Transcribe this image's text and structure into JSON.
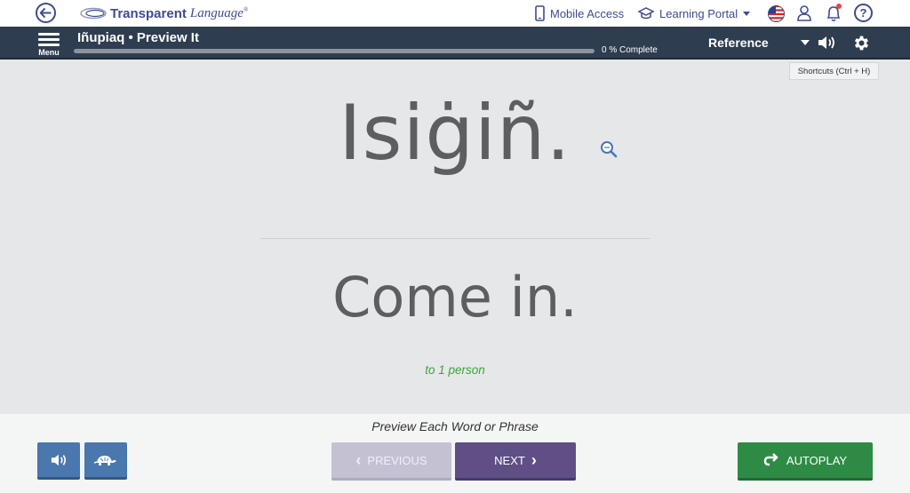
{
  "header": {
    "brand": "Transparent",
    "brand_suffix": "Language",
    "mobile_access": "Mobile Access",
    "learning_portal": "Learning Portal",
    "help": "?"
  },
  "navbar": {
    "menu_label": "Menu",
    "lesson_title": "Iñupiaq • Preview It",
    "progress_text": "0 % Complete",
    "progress_value": 0,
    "reference_label": "Reference",
    "shortcuts_hint": "Shortcuts (Ctrl + H)"
  },
  "card": {
    "target_phrase": "Isiġiñ.",
    "translation": "Come in.",
    "note": "to 1 person"
  },
  "controls": {
    "instruction": "Preview Each Word or Phrase",
    "previous_label": "PREVIOUS",
    "next_label": "NEXT",
    "autoplay_label": "AUTOPLAY"
  },
  "colors": {
    "brand": "#3f4b8f",
    "navbar": "#2e3d4f",
    "audio_button": "#4a77ae",
    "next_button": "#5f4f86",
    "previous_button_disabled": "#c4c1d3",
    "autoplay_button": "#2e8b45",
    "note_text": "#3aa53a"
  },
  "icons": {
    "back": "arrow-left-icon",
    "mobile": "phone-icon",
    "portal": "graduation-cap-icon",
    "language_flag": "us-flag-icon",
    "profile": "user-icon",
    "notifications": "bell-icon",
    "audio": "speaker-icon",
    "settings": "gear-icon",
    "zoom": "magnifier-icon",
    "slow_audio": "turtle-icon",
    "autoplay": "loop-arrow-icon"
  }
}
